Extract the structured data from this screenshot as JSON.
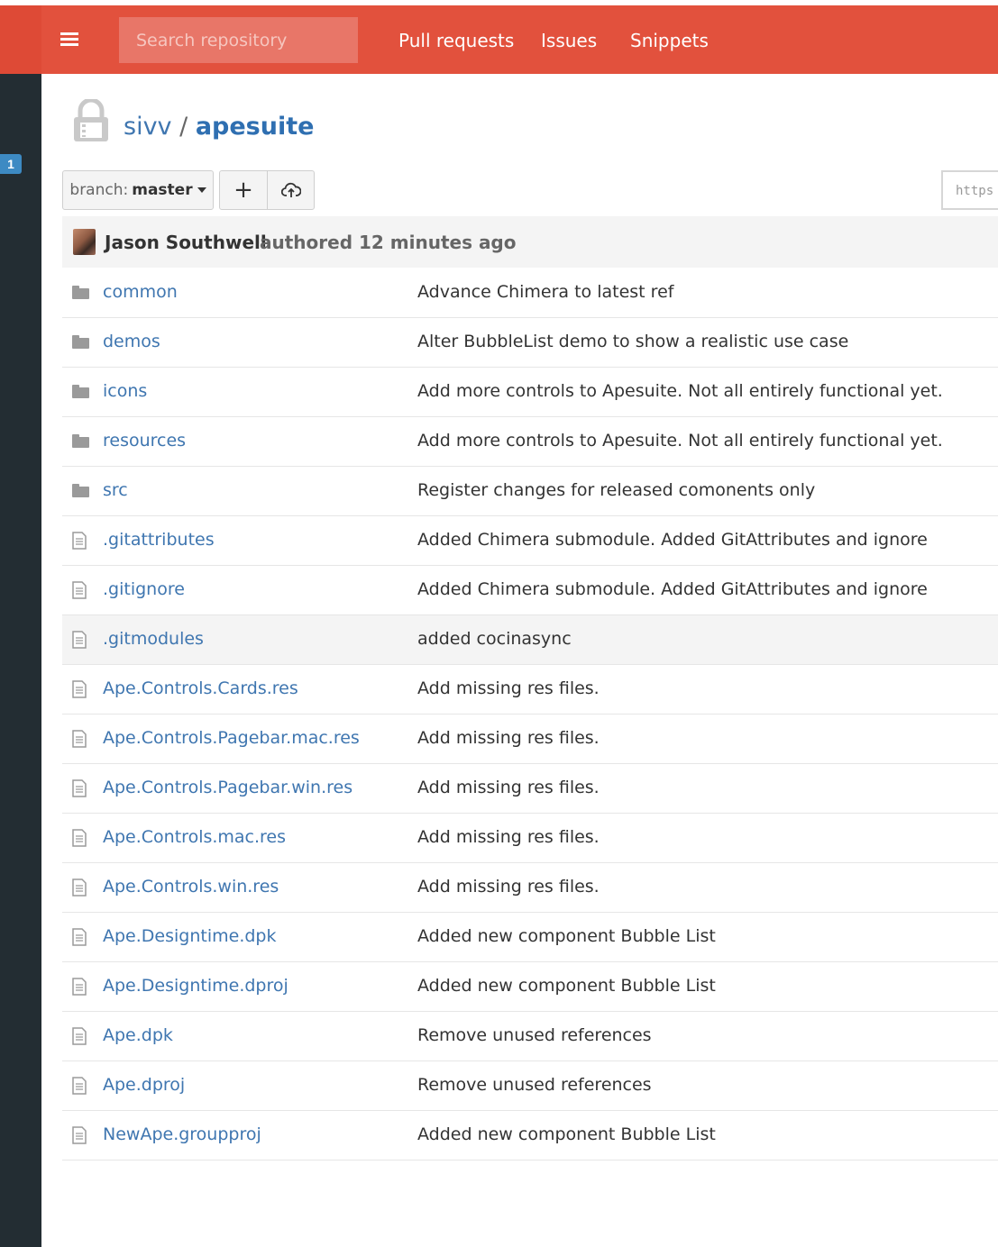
{
  "header": {
    "search_placeholder": "Search repository",
    "nav": [
      "Pull requests",
      "Issues",
      "Snippets"
    ],
    "accent": "#e2513d"
  },
  "sidebar": {
    "badge": "1"
  },
  "repo": {
    "owner": "sivv",
    "separator": "/",
    "name": "apesuite"
  },
  "toolbar": {
    "branch_label": "branch:",
    "branch_value": "master",
    "add_label": "+",
    "clone_url_fragment": "https"
  },
  "commit": {
    "author": "Jason Southwell",
    "authored_text": "authored 12 minutes ago"
  },
  "files": [
    {
      "type": "folder",
      "name": "common",
      "message": "Advance Chimera to latest ref"
    },
    {
      "type": "folder",
      "name": "demos",
      "message": "Alter BubbleList demo to show a realistic use case"
    },
    {
      "type": "folder",
      "name": "icons",
      "message": "Add more controls to Apesuite. Not all entirely functional yet."
    },
    {
      "type": "folder",
      "name": "resources",
      "message": "Add more controls to Apesuite. Not all entirely functional yet."
    },
    {
      "type": "folder",
      "name": "src",
      "message": "Register changes for released comonents only"
    },
    {
      "type": "file",
      "name": ".gitattributes",
      "message": "Added Chimera submodule. Added GitAttributes and ignore"
    },
    {
      "type": "file",
      "name": ".gitignore",
      "message": "Added Chimera submodule. Added GitAttributes and ignore"
    },
    {
      "type": "file",
      "name": ".gitmodules",
      "message": "added cocinasync",
      "highlight": true
    },
    {
      "type": "file",
      "name": "Ape.Controls.Cards.res",
      "message": "Add missing res files."
    },
    {
      "type": "file",
      "name": "Ape.Controls.Pagebar.mac.res",
      "message": "Add missing res files."
    },
    {
      "type": "file",
      "name": "Ape.Controls.Pagebar.win.res",
      "message": "Add missing res files."
    },
    {
      "type": "file",
      "name": "Ape.Controls.mac.res",
      "message": "Add missing res files."
    },
    {
      "type": "file",
      "name": "Ape.Controls.win.res",
      "message": "Add missing res files."
    },
    {
      "type": "file",
      "name": "Ape.Designtime.dpk",
      "message": "Added new component Bubble List"
    },
    {
      "type": "file",
      "name": "Ape.Designtime.dproj",
      "message": "Added new component Bubble List"
    },
    {
      "type": "file",
      "name": "Ape.dpk",
      "message": "Remove unused references"
    },
    {
      "type": "file",
      "name": "Ape.dproj",
      "message": "Remove unused references"
    },
    {
      "type": "file",
      "name": "NewApe.groupproj",
      "message": "Added new component Bubble List"
    }
  ]
}
